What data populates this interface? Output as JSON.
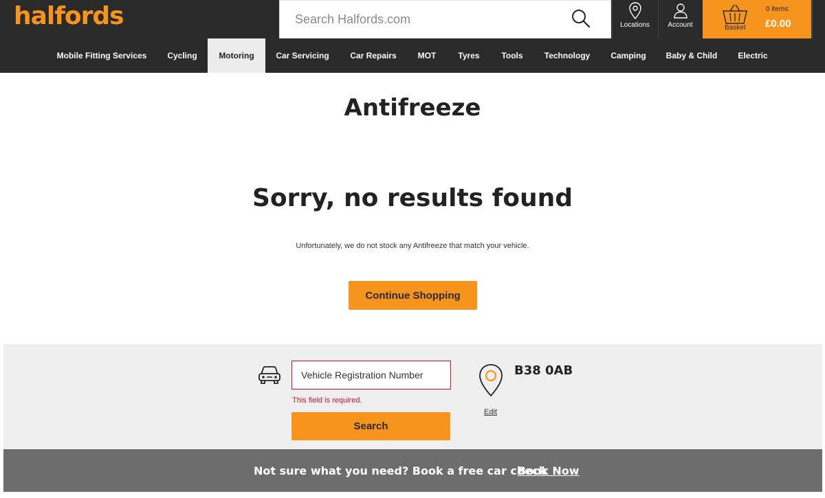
{
  "header": {
    "logo": "halfords",
    "search_placeholder": "Search Halfords.com",
    "locations_label": "Locations",
    "account_label": "Account",
    "basket_label": "Basket",
    "basket_items": "0 items:",
    "basket_total": "£0.00",
    "accent_color": "#f7941d",
    "background_color": "#2a2a2a"
  },
  "nav": {
    "items": [
      {
        "label": "Mobile Fitting Services"
      },
      {
        "label": "Cycling"
      },
      {
        "label": "Motoring",
        "active": true
      },
      {
        "label": "Car Servicing"
      },
      {
        "label": "Car Repairs"
      },
      {
        "label": "MOT"
      },
      {
        "label": "Tyres"
      },
      {
        "label": "Tools"
      },
      {
        "label": "Technology"
      },
      {
        "label": "Camping"
      },
      {
        "label": "Baby & Child"
      },
      {
        "label": "Electric"
      }
    ]
  },
  "main": {
    "title": "Antifreeze",
    "no_results_heading": "Sorry, no results found",
    "no_results_message": "Unfortunately, we do not stock any Antifreeze that match your vehicle.",
    "continue_button": "Continue Shopping"
  },
  "vehicle": {
    "reg_placeholder": "Vehicle Registration Number",
    "error": "This field is required.",
    "search_button": "Search",
    "postcode": "B38 0AB",
    "edit_label": "Edit",
    "error_color": "#c8102e"
  },
  "banner": {
    "text": "Not sure what you need? Book a free car check",
    "link": "Book Now"
  }
}
